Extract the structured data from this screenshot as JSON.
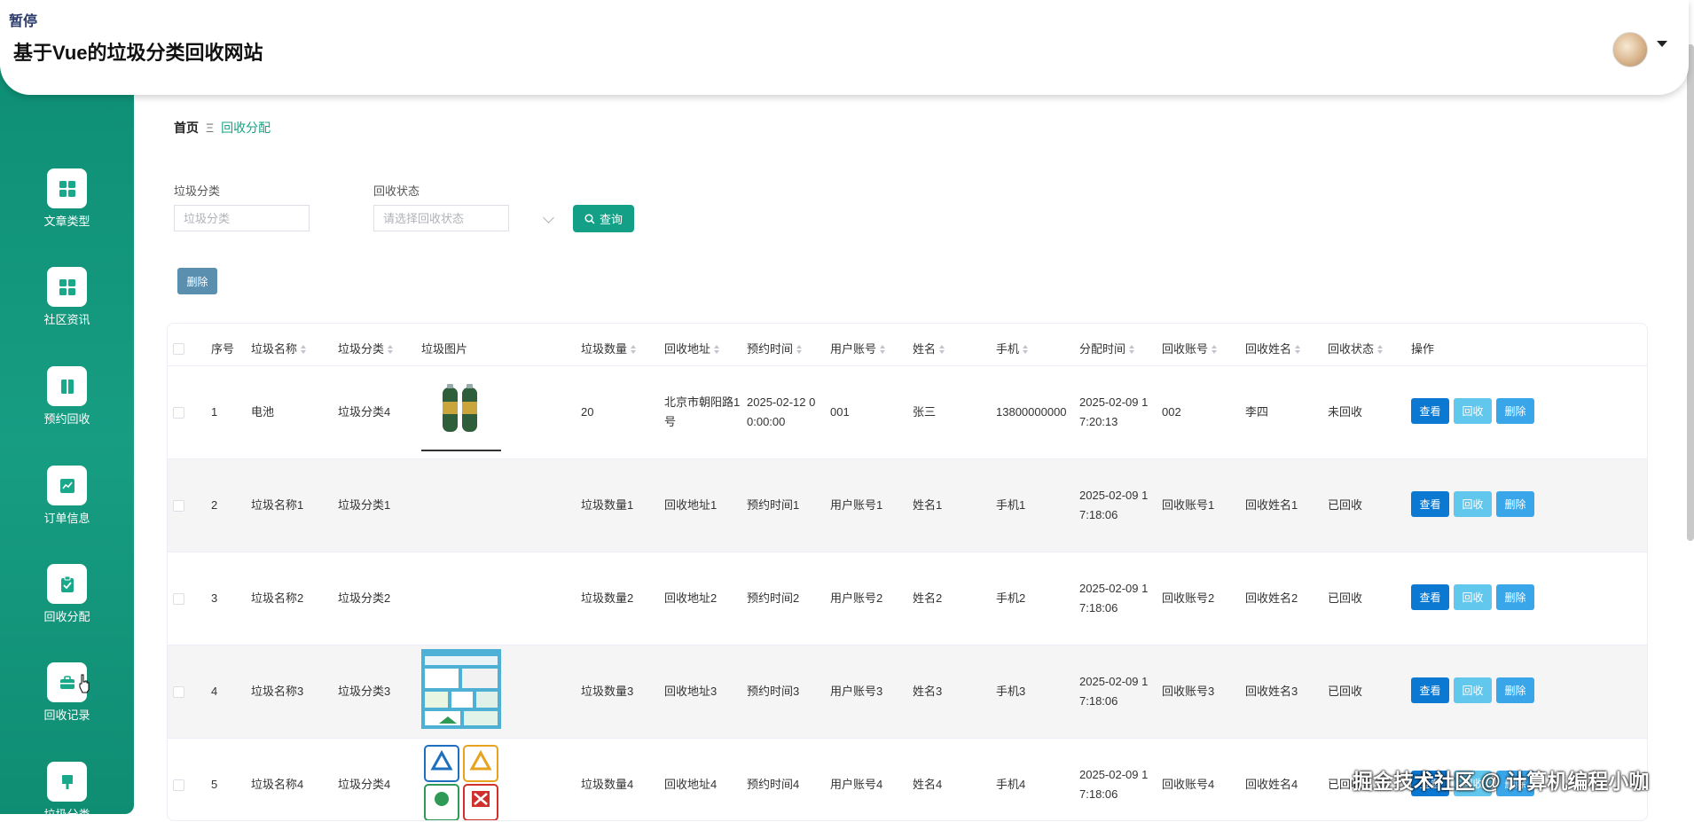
{
  "header": {
    "pause_label": "暂停",
    "title": "基于Vue的垃圾分类回收网站"
  },
  "sidebar": {
    "items": [
      {
        "label": "文章类型",
        "icon": "grid-icon"
      },
      {
        "label": "社区资讯",
        "icon": "grid-icon"
      },
      {
        "label": "预约回收",
        "icon": "book-icon"
      },
      {
        "label": "订单信息",
        "icon": "chart-icon"
      },
      {
        "label": "回收分配",
        "icon": "clipboard-icon"
      },
      {
        "label": "回收记录",
        "icon": "briefcase-icon"
      },
      {
        "label": "垃圾分类",
        "icon": "brush-icon"
      }
    ]
  },
  "breadcrumb": {
    "home": "首页",
    "separator": "Ξ",
    "current": "回收分配"
  },
  "filters": {
    "category_label": "垃圾分类",
    "category_placeholder": "垃圾分类",
    "status_label": "回收状态",
    "status_placeholder": "请选择回收状态",
    "query_label": "查询"
  },
  "toolbar": {
    "delete_label": "删除"
  },
  "table": {
    "columns": [
      "序号",
      "垃圾名称",
      "垃圾分类",
      "垃圾图片",
      "垃圾数量",
      "回收地址",
      "预约时间",
      "用户账号",
      "姓名",
      "手机",
      "分配时间",
      "回收账号",
      "回收姓名",
      "回收状态",
      "操作"
    ],
    "rows": [
      {
        "no": "1",
        "name": "电池",
        "category": "垃圾分类4",
        "image": "battery",
        "qty": "20",
        "address": "北京市朝阳路1号",
        "appt": "2025-02-12 00:00:00",
        "account": "001",
        "person": "张三",
        "phone": "13800000000",
        "assigned": "2025-02-09 17:20:13",
        "rec_account": "002",
        "rec_name": "李四",
        "status": "未回收"
      },
      {
        "no": "2",
        "name": "垃圾名称1",
        "category": "垃圾分类1",
        "image": "none",
        "qty": "垃圾数量1",
        "address": "回收地址1",
        "appt": "预约时间1",
        "account": "用户账号1",
        "person": "姓名1",
        "phone": "手机1",
        "assigned": "2025-02-09 17:18:06",
        "rec_account": "回收账号1",
        "rec_name": "回收姓名1",
        "status": "已回收"
      },
      {
        "no": "3",
        "name": "垃圾名称2",
        "category": "垃圾分类2",
        "image": "none",
        "qty": "垃圾数量2",
        "address": "回收地址2",
        "appt": "预约时间2",
        "account": "用户账号2",
        "person": "姓名2",
        "phone": "手机2",
        "assigned": "2025-02-09 17:18:06",
        "rec_account": "回收账号2",
        "rec_name": "回收姓名2",
        "status": "已回收"
      },
      {
        "no": "4",
        "name": "垃圾名称3",
        "category": "垃圾分类3",
        "image": "poster",
        "qty": "垃圾数量3",
        "address": "回收地址3",
        "appt": "预约时间3",
        "account": "用户账号3",
        "person": "姓名3",
        "phone": "手机3",
        "assigned": "2025-02-09 17:18:06",
        "rec_account": "回收账号3",
        "rec_name": "回收姓名3",
        "status": "已回收"
      },
      {
        "no": "5",
        "name": "垃圾名称4",
        "category": "垃圾分类4",
        "image": "signs",
        "qty": "垃圾数量4",
        "address": "回收地址4",
        "appt": "预约时间4",
        "account": "用户账号4",
        "person": "姓名4",
        "phone": "手机4",
        "assigned": "2025-02-09 17:18:06",
        "rec_account": "回收账号4",
        "rec_name": "回收姓名4",
        "status": "已回收"
      }
    ],
    "actions": {
      "view": "查看",
      "recycle": "回收",
      "delete": "删除"
    }
  },
  "watermark": "掘金技术社区 @ 计算机编程小咖",
  "colors": {
    "sidebar": "#129a7f",
    "primary": "#14a087",
    "view": "#0b78d1",
    "recycle": "#62c7ec",
    "delete": "#39a6ea"
  }
}
